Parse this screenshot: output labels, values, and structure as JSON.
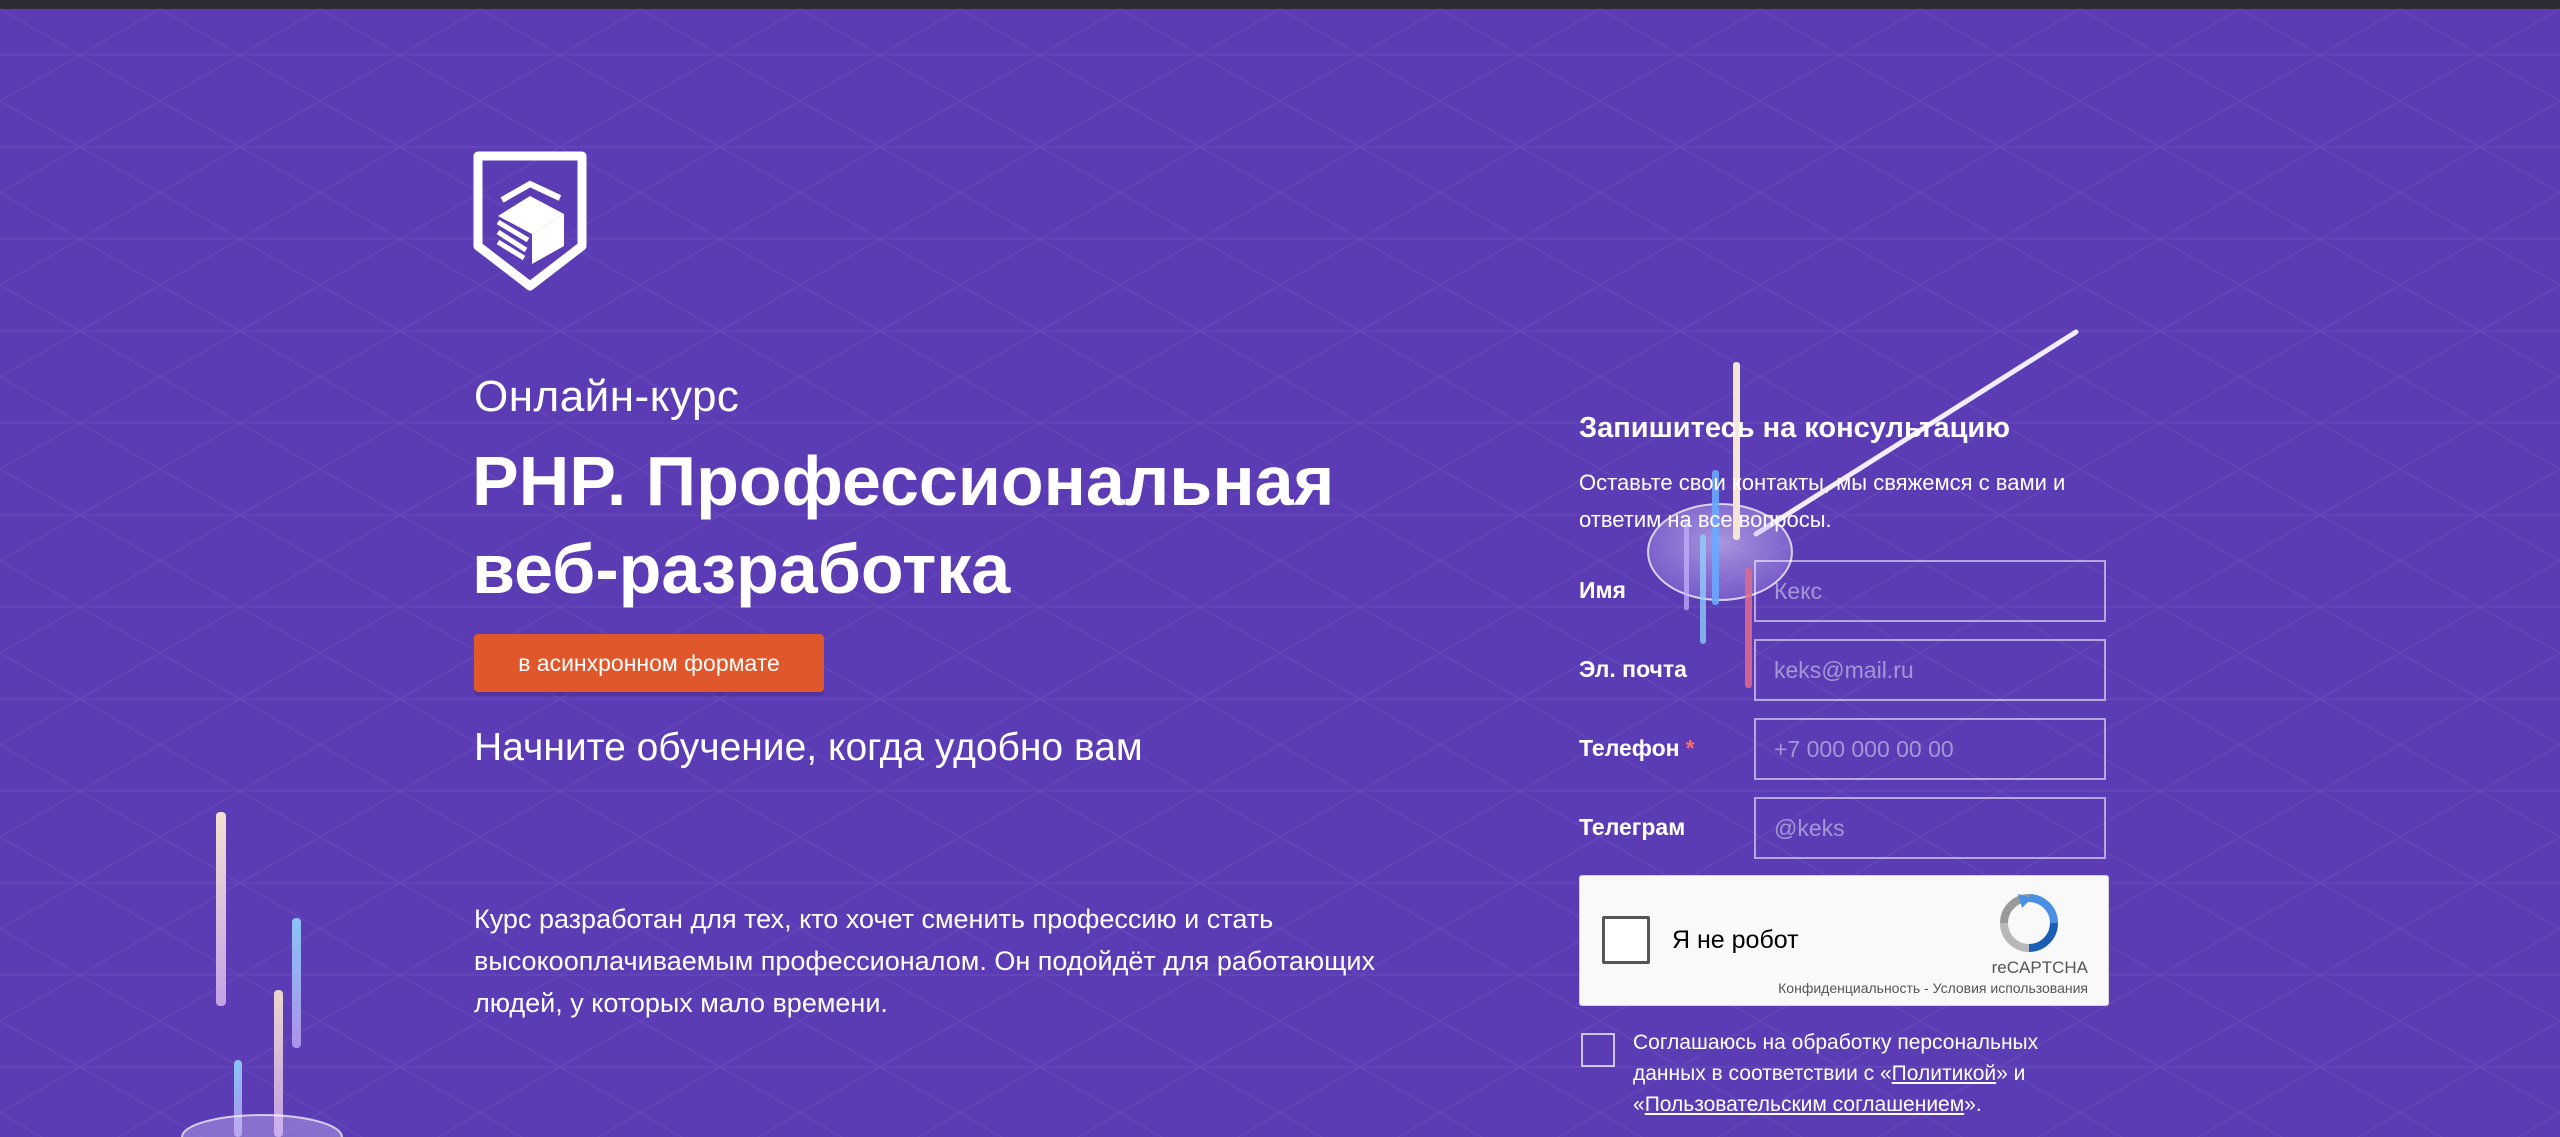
{
  "hero": {
    "eyebrow": "Онлайн-курс",
    "title_line1": "PHP. Профессиональная",
    "title_line2": "веб-разработка",
    "format_badge": "в асинхронном формате",
    "subtitle": "Начните обучение, когда удобно вам",
    "description": "Курс разработан для тех, кто хочет сменить профессию и стать высокооплачиваемым профессионалом. Он подойдёт для работающих людей, у которых мало времени."
  },
  "form": {
    "title": "Запишитесь на консультацию",
    "text": "Оставьте свои контакты, мы свяжемся с вами и ответим на все вопросы.",
    "fields": [
      {
        "label": "Имя",
        "placeholder": "Кекс",
        "required": false
      },
      {
        "label": "Эл. почта",
        "placeholder": "keks@mail.ru",
        "required": false
      },
      {
        "label": "Телефон",
        "placeholder": "+7 000 000 00 00",
        "required": true
      },
      {
        "label": "Телеграм",
        "placeholder": "@keks",
        "required": false
      }
    ],
    "required_mark": "*",
    "recaptcha": {
      "label": "Я не робот",
      "brand": "reCAPTCHA",
      "terms": "Конфиденциальность - Условия использования"
    },
    "consent": {
      "text_before": "Соглашаюсь на обработку персональных данных в соответствии с «",
      "policy_link": "Политикой",
      "text_middle": "» и «",
      "agreement_link": "Пользовательским соглашением",
      "text_after": "»."
    }
  },
  "icons": {
    "logo": "shield-cube-logo-icon",
    "recaptcha": "recaptcha-arrows-icon"
  },
  "colors": {
    "background": "#5c3cb4",
    "accent": "#e0572c",
    "text": "#ffffff",
    "required": "#ff6a6a"
  }
}
